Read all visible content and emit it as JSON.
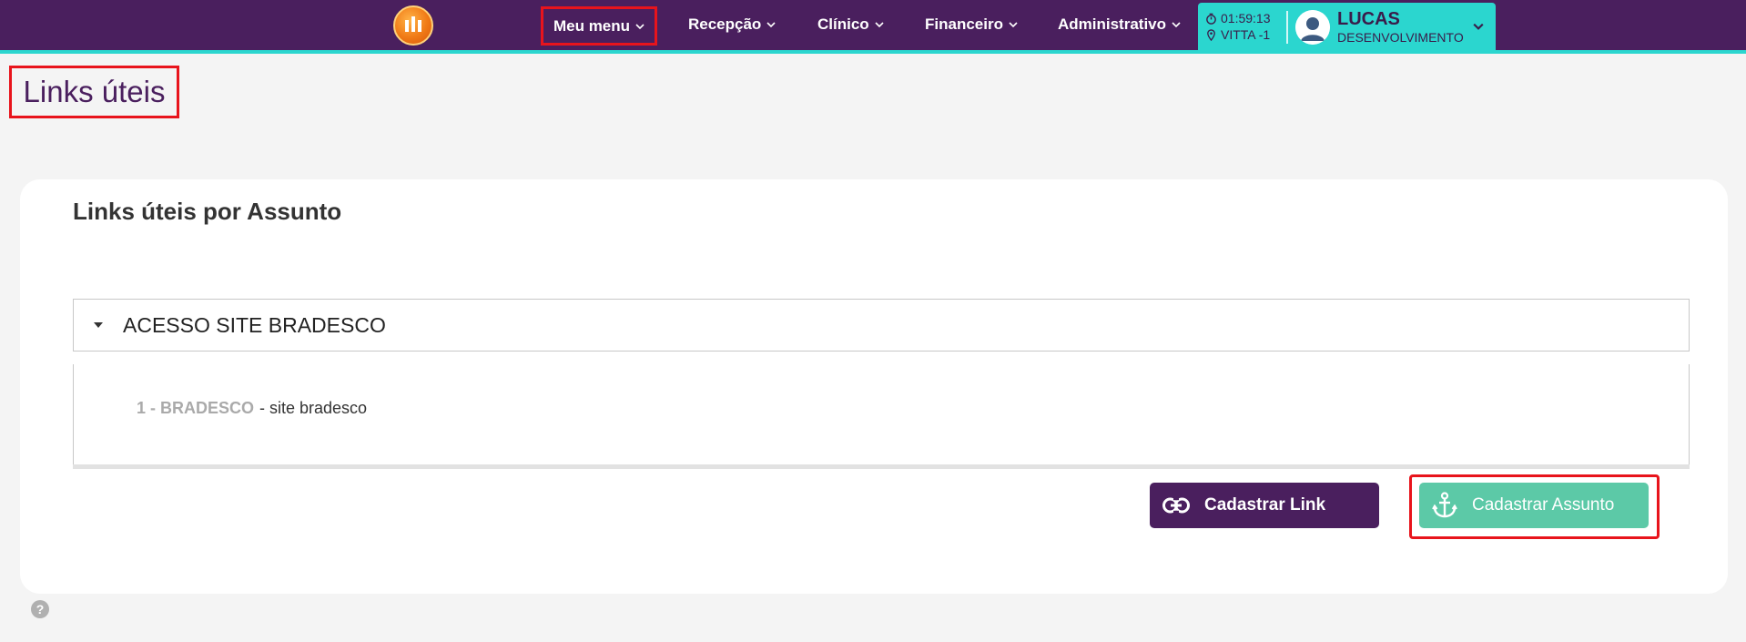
{
  "nav": {
    "items": [
      {
        "label": "Meu menu"
      },
      {
        "label": "Recepção"
      },
      {
        "label": "Clínico"
      },
      {
        "label": "Financeiro"
      },
      {
        "label": "Administrativo"
      }
    ]
  },
  "user": {
    "time": "01:59:13",
    "location": "VITTA -1",
    "name": "LUCAS",
    "role": "DESENVOLVIMENTO"
  },
  "page": {
    "title": "Links úteis"
  },
  "card": {
    "title": "Links úteis por Assunto",
    "accordion": {
      "title": "ACESSO SITE BRADESCO",
      "links": [
        {
          "number": "1 - BRADESCO",
          "desc": "- site bradesco"
        }
      ]
    },
    "buttons": {
      "link_label": "Cadastrar Link",
      "assunto_label": "Cadastrar Assunto"
    }
  },
  "help": {
    "label": "?"
  },
  "colors": {
    "nav_bg": "#4a1f5e",
    "accent": "#2bd6cf",
    "primary_button": "#4a1f5e",
    "secondary_button": "#5cc9a7",
    "highlight": "#e8141c"
  }
}
